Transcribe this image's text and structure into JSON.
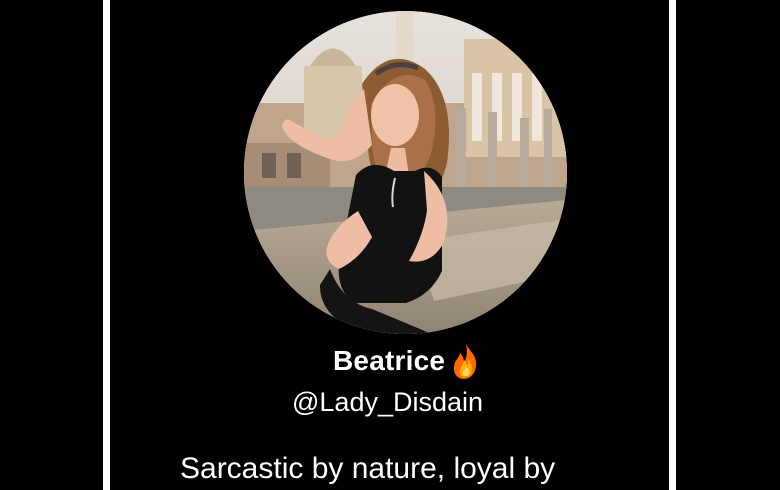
{
  "profile": {
    "name": "Beatrice",
    "handle": "@Lady_Disdain",
    "bio": "Sarcastic by nature, loyal by",
    "name_emoji_icon": "fire-icon",
    "avatar_icon": "profile-photo"
  },
  "colors": {
    "background": "#000000",
    "text": "#ffffff",
    "frame": "#ffffff"
  }
}
